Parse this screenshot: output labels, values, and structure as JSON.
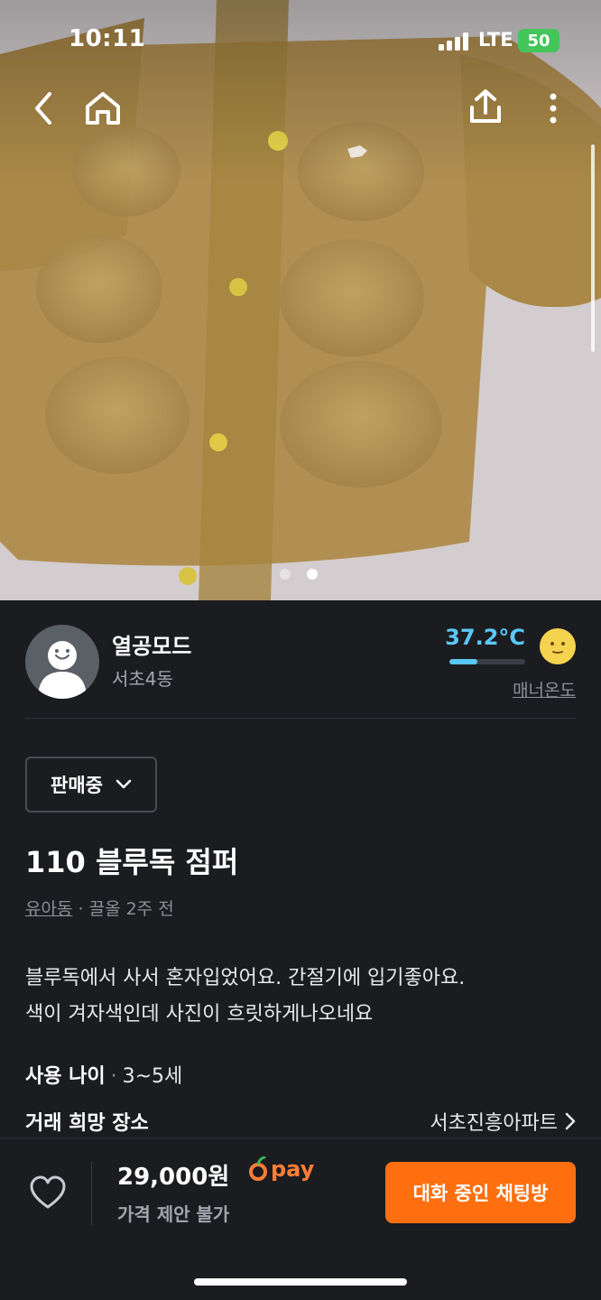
{
  "status_bar": {
    "time": "10:11",
    "network": "LTE",
    "battery": "50"
  },
  "icons": {
    "back": "chevron-left-icon",
    "home": "home-icon",
    "share": "share-icon",
    "more": "more-vertical-icon",
    "heart": "heart-icon",
    "chevron_down": "chevron-down-icon",
    "chevron_right": "chevron-right-icon"
  },
  "gallery": {
    "image_count": 2,
    "active_index": 1
  },
  "seller": {
    "nickname": "열공모드",
    "region": "서초4동",
    "temperature": "37.2°C",
    "temperature_level": 0.372,
    "temperature_color": "#5ac8fa",
    "manner_label": "매너온도"
  },
  "product": {
    "status": "판매중",
    "title": "110 블루독 점퍼",
    "category": "유아동",
    "time_ago": "끌올 2주 전",
    "description": [
      "블루독에서 사서 혼자입었어요. 간절기에 입기좋아요.",
      "색이 겨자색인데 사진이 흐릿하게나오네요"
    ],
    "age_label": "사용 나이",
    "age_value": "3~5세",
    "place_label": "거래 희망 장소",
    "place_value": "서초진흥아파트"
  },
  "bottom": {
    "price": "29,000원",
    "pay_label": "pay",
    "offer_text": "가격 제안 불가",
    "chat_button": "대화 중인 채팅방",
    "accent_color": "#ff6f0f"
  }
}
